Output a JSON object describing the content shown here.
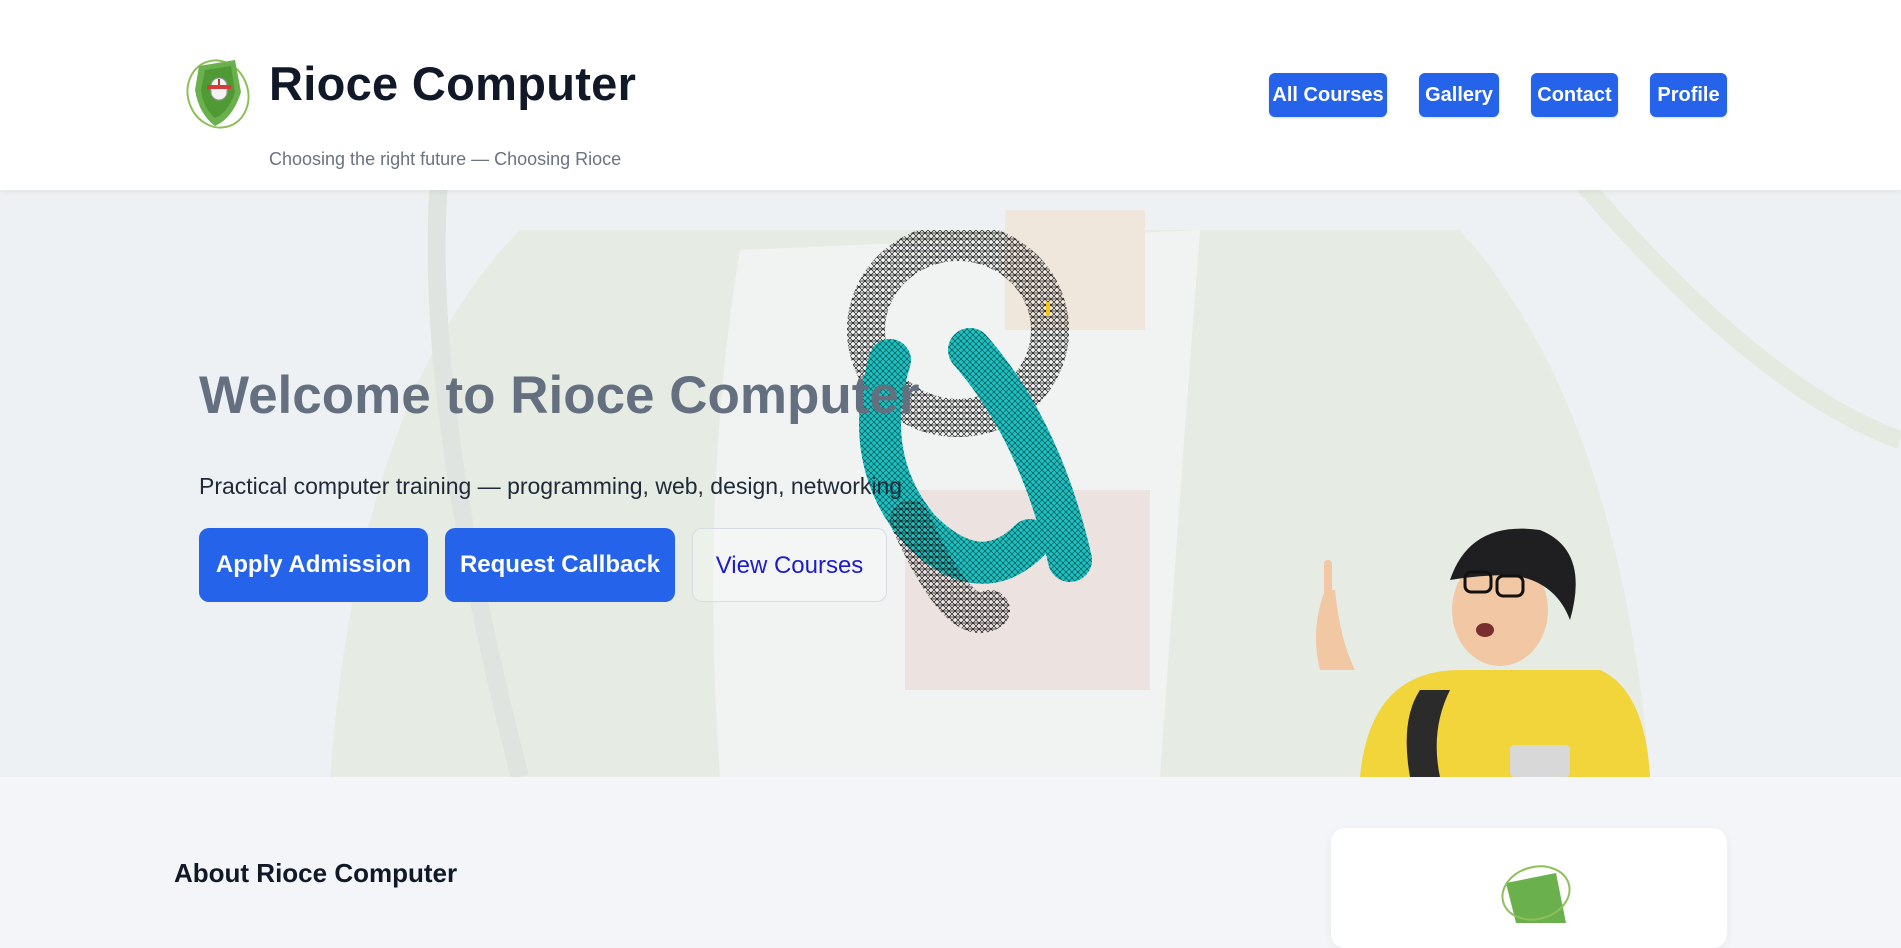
{
  "header": {
    "brand_name": "Rioce Computer",
    "tagline": "Choosing the right future — Choosing Rioce",
    "nav": [
      {
        "label": "All Courses"
      },
      {
        "label": "Gallery"
      },
      {
        "label": "Contact"
      },
      {
        "label": "Profile"
      }
    ]
  },
  "hero": {
    "title": "Welcome to Rioce Computer",
    "subtitle": "Practical computer training — programming, web, design, networking",
    "buttons": {
      "apply": "Apply Admission",
      "callback": "Request Callback",
      "courses": "View Courses"
    }
  },
  "about": {
    "title": "About Rioce Computer"
  },
  "colors": {
    "accent": "#2563eb",
    "outline_text": "#1d1ccd",
    "hero_title": "#64707f",
    "logo_green": "#6ab04c"
  },
  "icons": {
    "logo": "shield-mouse-logo",
    "hero_graphic": "wireframe-knot",
    "hero_person": "student-pointing"
  }
}
